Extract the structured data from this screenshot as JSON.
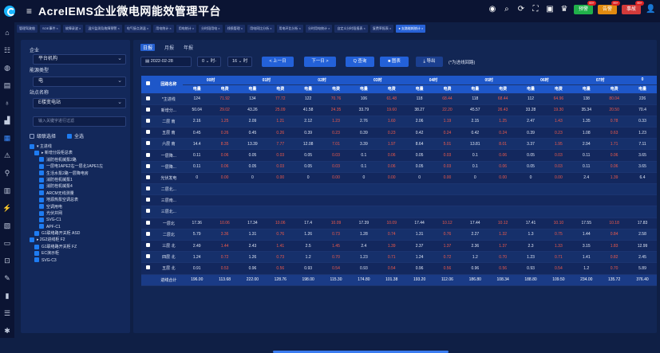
{
  "app": {
    "title": "AcrelEMS企业微电网能效管理平台"
  },
  "top_badges": [
    {
      "label": "预警",
      "count": "99+",
      "color": "#20b04a"
    },
    {
      "label": "告警",
      "count": "99+",
      "color": "#e08a10"
    },
    {
      "label": "事故",
      "count": "99+",
      "color": "#d23a3a"
    }
  ],
  "tabs": [
    {
      "label": "管理驾驶舱"
    },
    {
      "label": "SOE事件 ×"
    },
    {
      "label": "故障录波 ×"
    },
    {
      "label": "温升监测及故障预警 ×"
    },
    {
      "label": "电气接点测温 ×"
    },
    {
      "label": "用电统计 ×"
    },
    {
      "label": "用电统计 ×"
    },
    {
      "label": "分时段用电 ×"
    },
    {
      "label": "线损管理 ×"
    },
    {
      "label": "用电同比分析 ×"
    },
    {
      "label": "用电环比分析 ×"
    },
    {
      "label": "分时用电统计 ×"
    },
    {
      "label": "自定义分时段报表 ×"
    },
    {
      "label": "复费率报表 ×"
    },
    {
      "label": "● 支路能耗统计 ×"
    }
  ],
  "filter": {
    "enterprise_label": "企业",
    "enterprise_value": "平台机构",
    "energy_type_label": "能源类型",
    "energy_type_value": "电",
    "station_label": "站点名称",
    "station_value": "E楼变电站",
    "search_placeholder": "输入关键字进行过滤",
    "cascade_label": "级联选择",
    "select_all_label": "全选"
  },
  "tree": [
    {
      "label": "▾ 主进线",
      "indent": 0
    },
    {
      "label": "▸ 新增分段柜总表",
      "indent": 1
    },
    {
      "label": "消防栓机械泵2路",
      "indent": 2
    },
    {
      "label": "一层电1APE2右一层北1APE1左",
      "indent": 2
    },
    {
      "label": "生活水泵2路一层降电房",
      "indent": 2
    },
    {
      "label": "消防栓机械泵1",
      "indent": 2
    },
    {
      "label": "消防栓机械泵4",
      "indent": 2
    },
    {
      "label": "ARCM无线测量",
      "indent": 2
    },
    {
      "label": "地源热泵空调总表",
      "indent": 2
    },
    {
      "label": "空调用电",
      "indent": 2
    },
    {
      "label": "光伏并网",
      "indent": 2
    },
    {
      "label": "SVG-C1",
      "indent": 2
    },
    {
      "label": "APF-C1",
      "indent": 2
    },
    {
      "label": "G1联络路开关柜 ASD",
      "indent": 1
    },
    {
      "label": "▸ 2G2进线柜 F2",
      "indent": 0
    },
    {
      "label": "G1联络路开关柜 FZ",
      "indent": 1
    },
    {
      "label": "EC演示柜",
      "indent": 1
    },
    {
      "label": "SVG-C3",
      "indent": 1
    }
  ],
  "report": {
    "tabs": [
      "日报",
      "月报",
      "年报"
    ],
    "date": "2022-02-28",
    "hour_from": "0",
    "hour_from_unit": "时-",
    "hour_to": "16",
    "hour_to_unit": "时",
    "prev_label": "< 上一日",
    "next_label": "下一日 >",
    "query_label": "Q 查询",
    "chart_label": "■ 图表",
    "export_label": "⤓ 导出",
    "note": "(*为进线回路)"
  },
  "table": {
    "name_header": "回路名称",
    "hours": [
      "00时",
      "01时",
      "02时",
      "03时",
      "04时",
      "05时",
      "06时",
      "07时",
      "0"
    ],
    "sub_headers": [
      "电量",
      "电费"
    ],
    "rows": [
      {
        "name": "*主进线",
        "cells": [
          "124",
          "71.92",
          "134",
          "77.72",
          "122",
          "70.76",
          "106",
          "61.48",
          "118",
          "68.44",
          "118",
          "68.44",
          "112",
          "64.96",
          "138",
          "80.04",
          "226"
        ]
      },
      {
        "name": "新增分...",
        "cells": [
          "50.04",
          "29.02",
          "43.26",
          "25.09",
          "41.58",
          "24.35",
          "33.79",
          "19.60",
          "38.27",
          "22.20",
          "45.57",
          "26.43",
          "33.28",
          "19.30",
          "35.34",
          "20.50",
          "70.4"
        ]
      },
      {
        "name": "二层 南",
        "cells": [
          "2.16",
          "1.25",
          "2.09",
          "1.21",
          "2.12",
          "1.23",
          "2.76",
          "1.60",
          "2.06",
          "1.19",
          "2.15",
          "1.25",
          "2.47",
          "1.43",
          "1.35",
          "0.78",
          "0.33"
        ]
      },
      {
        "name": "五层 南",
        "cells": [
          "0.45",
          "0.26",
          "0.45",
          "0.26",
          "0.39",
          "0.23",
          "0.39",
          "0.23",
          "0.42",
          "0.24",
          "0.42",
          "0.24",
          "0.39",
          "0.23",
          "1.08",
          "0.63",
          "1.23"
        ]
      },
      {
        "name": "六层 南",
        "cells": [
          "14.4",
          "8.35",
          "13.39",
          "7.77",
          "12.08",
          "7.01",
          "3.39",
          "1.97",
          "8.64",
          "5.01",
          "13.81",
          "8.01",
          "3.37",
          "1.95",
          "2.94",
          "1.71",
          "7.11"
        ]
      },
      {
        "name": "一层降...",
        "cells": [
          "0.11",
          "0.06",
          "0.05",
          "0.03",
          "0.05",
          "0.03",
          "0.1",
          "0.06",
          "0.05",
          "0.03",
          "0.1",
          "0.06",
          "0.05",
          "0.03",
          "0.11",
          "0.06",
          "3.65"
        ]
      },
      {
        "name": "一层降...",
        "cells": [
          "0.11",
          "0.06",
          "0.05",
          "0.03",
          "0.05",
          "0.03",
          "0.1",
          "0.06",
          "0.05",
          "0.03",
          "0.1",
          "0.06",
          "0.05",
          "0.03",
          "0.11",
          "0.06",
          "3.65"
        ]
      },
      {
        "name": "光伏发电",
        "cells": [
          "0",
          "0.00",
          "0",
          "0.00",
          "0",
          "0.00",
          "0",
          "0.00",
          "0",
          "0.00",
          "0",
          "0.00",
          "0",
          "0.00",
          "2.4",
          "1.39",
          "6.4"
        ]
      },
      {
        "name": "二层北...",
        "cells": [
          "",
          "",
          "",
          "",
          "",
          "",
          "",
          "",
          "",
          "",
          "",
          "",
          "",
          "",
          "",
          "",
          ""
        ]
      },
      {
        "name": "三层南...",
        "cells": [
          "",
          "",
          "",
          "",
          "",
          "",
          "",
          "",
          "",
          "",
          "",
          "",
          "",
          "",
          "",
          "",
          ""
        ]
      },
      {
        "name": "三层北...",
        "cells": [
          "",
          "",
          "",
          "",
          "",
          "",
          "",
          "",
          "",
          "",
          "",
          "",
          "",
          "",
          "",
          "",
          ""
        ]
      },
      {
        "name": "一层北",
        "cells": [
          "17.36",
          "10.06",
          "17.34",
          "10.06",
          "17.4",
          "10.09",
          "17.39",
          "10.09",
          "17.44",
          "10.12",
          "17.44",
          "10.12",
          "17.41",
          "10.10",
          "17.55",
          "10.18",
          "17.83"
        ]
      },
      {
        "name": "二层北",
        "cells": [
          "5.79",
          "3.36",
          "1.31",
          "0.76",
          "1.26",
          "0.73",
          "1.28",
          "0.74",
          "1.31",
          "0.76",
          "2.27",
          "1.32",
          "1.3",
          "0.75",
          "1.44",
          "0.84",
          "2.58"
        ]
      },
      {
        "name": "三层 北",
        "cells": [
          "2.49",
          "1.44",
          "2.43",
          "1.41",
          "2.5",
          "1.45",
          "2.4",
          "1.39",
          "2.37",
          "1.37",
          "2.36",
          "1.37",
          "2.3",
          "1.33",
          "3.15",
          "1.83",
          "12.99"
        ]
      },
      {
        "name": "四层 北",
        "cells": [
          "1.24",
          "0.72",
          "1.26",
          "0.73",
          "1.2",
          "0.70",
          "1.23",
          "0.71",
          "1.24",
          "0.72",
          "1.2",
          "0.70",
          "1.23",
          "0.71",
          "1.41",
          "0.82",
          "2.45"
        ]
      },
      {
        "name": "五层 北",
        "cells": [
          "0.91",
          "0.53",
          "0.96",
          "0.56",
          "0.93",
          "0.54",
          "0.93",
          "0.54",
          "0.96",
          "0.56",
          "0.96",
          "0.56",
          "0.93",
          "0.54",
          "1.2",
          "0.70",
          "5.89"
        ]
      }
    ],
    "total": {
      "name": "进线合计",
      "cells": [
        "196.00",
        "113.68",
        "222.00",
        "128.76",
        "198.00",
        "115.30",
        "174.80",
        "101.38",
        "193.20",
        "112.06",
        "186.80",
        "108.34",
        "188.80",
        "109.50",
        "234.00",
        "135.72",
        "376.40"
      ]
    }
  }
}
